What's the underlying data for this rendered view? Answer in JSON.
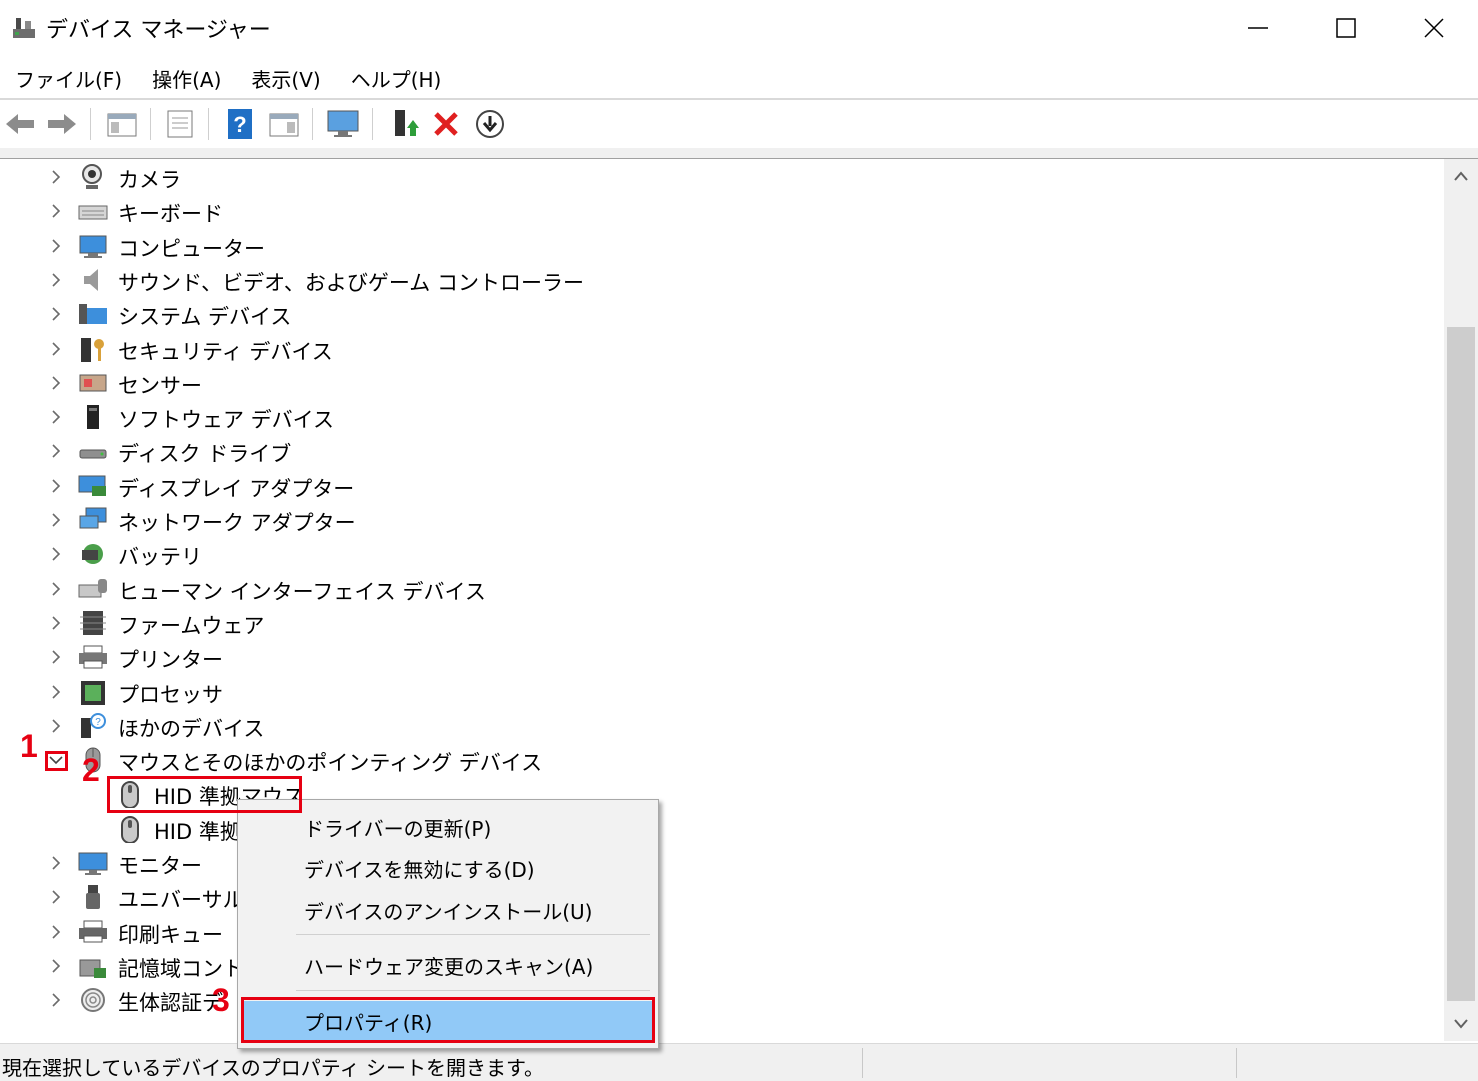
{
  "window": {
    "title": "デバイス マネージャー"
  },
  "menu": [
    "ファイル(F)",
    "操作(A)",
    "表示(V)",
    "ヘルプ(H)"
  ],
  "tree": {
    "categories_top": [
      {
        "label": "カメラ",
        "icon": "camera-icon"
      },
      {
        "label": "キーボード",
        "icon": "keyboard-icon"
      },
      {
        "label": "コンピューター",
        "icon": "computer-icon"
      },
      {
        "label": "サウンド、ビデオ、およびゲーム コントローラー",
        "icon": "speaker-icon"
      },
      {
        "label": "システム デバイス",
        "icon": "system-folder-icon"
      },
      {
        "label": "セキュリティ デバイス",
        "icon": "security-key-icon"
      },
      {
        "label": "センサー",
        "icon": "sensor-icon"
      },
      {
        "label": "ソフトウェア デバイス",
        "icon": "software-device-icon"
      },
      {
        "label": "ディスク ドライブ",
        "icon": "disk-drive-icon"
      },
      {
        "label": "ディスプレイ アダプター",
        "icon": "display-adapter-icon"
      },
      {
        "label": "ネットワーク アダプター",
        "icon": "network-adapter-icon"
      },
      {
        "label": "バッテリ",
        "icon": "battery-icon"
      },
      {
        "label": "ヒューマン インターフェイス デバイス",
        "icon": "hid-icon"
      },
      {
        "label": "ファームウェア",
        "icon": "firmware-icon"
      },
      {
        "label": "プリンター",
        "icon": "printer-icon"
      },
      {
        "label": "プロセッサ",
        "icon": "processor-icon"
      },
      {
        "label": "ほかのデバイス",
        "icon": "unknown-device-icon"
      }
    ],
    "expanded": {
      "label": "マウスとそのほかのポインティング デバイス",
      "children": [
        "HID 準拠マウス",
        "HID 準拠"
      ]
    },
    "categories_bottom": [
      {
        "label": "モニター",
        "icon": "monitor-icon"
      },
      {
        "label": "ユニバーサル シ",
        "icon": "usb-icon"
      },
      {
        "label": "印刷キュー",
        "icon": "print-queue-icon"
      },
      {
        "label": "記憶域コント",
        "icon": "storage-controller-icon"
      },
      {
        "label": "生体認証デ",
        "icon": "fingerprint-icon"
      }
    ]
  },
  "context_menu": {
    "update_driver": "ドライバーの更新(P)",
    "disable_device": "デバイスを無効にする(D)",
    "uninstall_device": "デバイスのアンインストール(U)",
    "scan_hardware": "ハードウェア変更のスキャン(A)",
    "properties": "プロパティ(R)"
  },
  "annotations": [
    "1",
    "2",
    "3"
  ],
  "status": {
    "text": "現在選択しているデバイスのプロパティ シートを開きます。"
  },
  "colors": {
    "highlight": "#91c9f7",
    "annotation_red": "#e60012"
  }
}
